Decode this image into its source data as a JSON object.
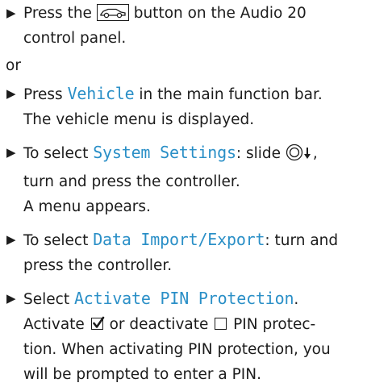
{
  "bullet": "▶",
  "step1": {
    "prefix": "Press the",
    "icon": "car-icon",
    "suffix": "button on the Audio 20",
    "line2": "control panel."
  },
  "or_text": "or",
  "step2": {
    "prefix": "Press",
    "highlight": "Vehicle",
    "suffix": "in the main function bar.",
    "line2": "The vehicle menu is displayed."
  },
  "step3": {
    "prefix": "To select",
    "highlight": "System Settings",
    "suffix": ": slide",
    "icon": "controller-slide-down-icon",
    "suffix2": ",",
    "line2": "turn and press the controller.",
    "line3": "A menu appears."
  },
  "step4": {
    "prefix": "To select",
    "highlight": "Data Import/Export",
    "suffix": ": turn and",
    "line2": "press the controller."
  },
  "step5": {
    "prefix": "Select",
    "highlight": "Activate PIN Protection",
    "suffix": ".",
    "line2_a": "Activate",
    "icon_checked": "checkbox-checked-icon",
    "line2_b": "or deactivate",
    "icon_unchecked": "checkbox-unchecked-icon",
    "line2_c": "PIN protec-",
    "line3": "tion. When activating PIN protection, you",
    "line4": "will be prompted to enter a PIN."
  },
  "colors": {
    "highlight": "#2a8fc7",
    "text": "#1c1c1c"
  }
}
